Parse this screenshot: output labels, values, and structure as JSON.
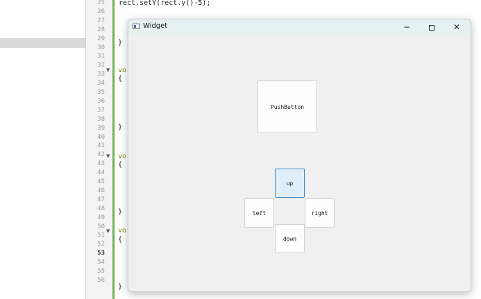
{
  "editor": {
    "line_numbers": [
      "25",
      "26",
      "27",
      "28",
      "29",
      "30",
      "31",
      "32",
      "33",
      "34",
      "35",
      "36",
      "37",
      "38",
      "39",
      "40",
      "41",
      "42",
      "43",
      "44",
      "45",
      "46",
      "47",
      "48",
      "49",
      "50",
      "51",
      "52",
      "53",
      "54",
      "55",
      "56"
    ],
    "current_line": "53",
    "code_line_25": "rect.setY(rect.y()-5);",
    "brace_close": "}",
    "brace_open": "{",
    "vo_fragment": "vo"
  },
  "window": {
    "title": "Widget",
    "minimize": "−",
    "close": "✕"
  },
  "buttons": {
    "push": "PushButton",
    "up": "up",
    "left": "left",
    "right": "right",
    "down": "down"
  }
}
